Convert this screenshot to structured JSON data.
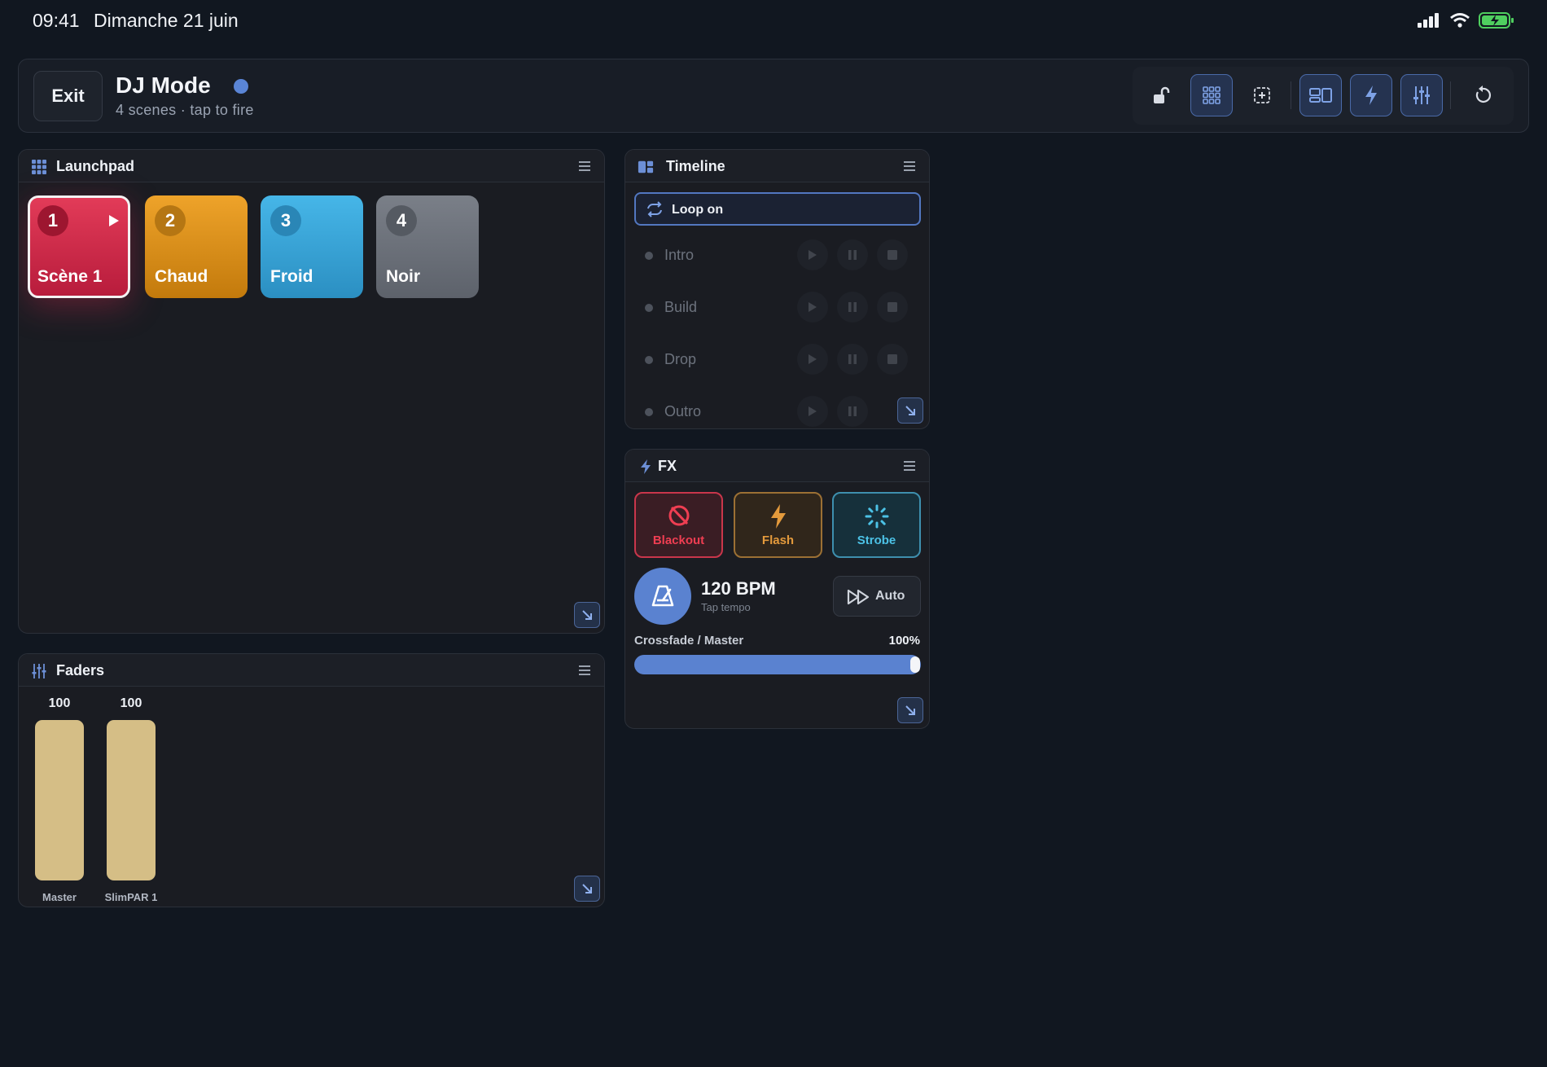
{
  "status_bar": {
    "time": "09:41",
    "date": "Dimanche 21 juin"
  },
  "header": {
    "exit_label": "Exit",
    "title": "DJ Mode",
    "subtitle": "4 scenes · tap to fire",
    "status_dot_color": "#5a85d6",
    "toolbar_icons": [
      "unlock-icon",
      "grid-icon",
      "add-widget-icon",
      "layout-icon",
      "lightning-icon",
      "sliders-icon",
      "reset-icon"
    ]
  },
  "launchpad": {
    "title": "Launchpad",
    "pads": [
      {
        "num": "1",
        "label": "Scène 1",
        "color": "#d0304e",
        "active": true
      },
      {
        "num": "2",
        "label": "Chaud",
        "color": "#e39818"
      },
      {
        "num": "3",
        "label": "Froid",
        "color": "#3aa9de"
      },
      {
        "num": "4",
        "label": "Noir",
        "color": "#6b7078"
      }
    ]
  },
  "timeline": {
    "title": "Timeline",
    "loop_label": "Loop on",
    "cues": [
      "Intro",
      "Build",
      "Drop",
      "Outro"
    ]
  },
  "fx": {
    "title": "FX",
    "buttons": [
      {
        "label": "Blackout",
        "color": "#ef3e52"
      },
      {
        "label": "Flash",
        "color": "#e49a3c"
      },
      {
        "label": "Strobe",
        "color": "#4cc2e6"
      }
    ],
    "bpm": "120 BPM",
    "tap_label": "Tap tempo",
    "auto_label": "Auto",
    "crossfade_label": "Crossfade / Master",
    "crossfade_value": "100%",
    "crossfade_level": 1.0
  },
  "faders": {
    "title": "Faders",
    "channels": [
      {
        "name": "Master",
        "value": "100"
      },
      {
        "name": "SlimPAR 1",
        "value": "100"
      }
    ]
  }
}
